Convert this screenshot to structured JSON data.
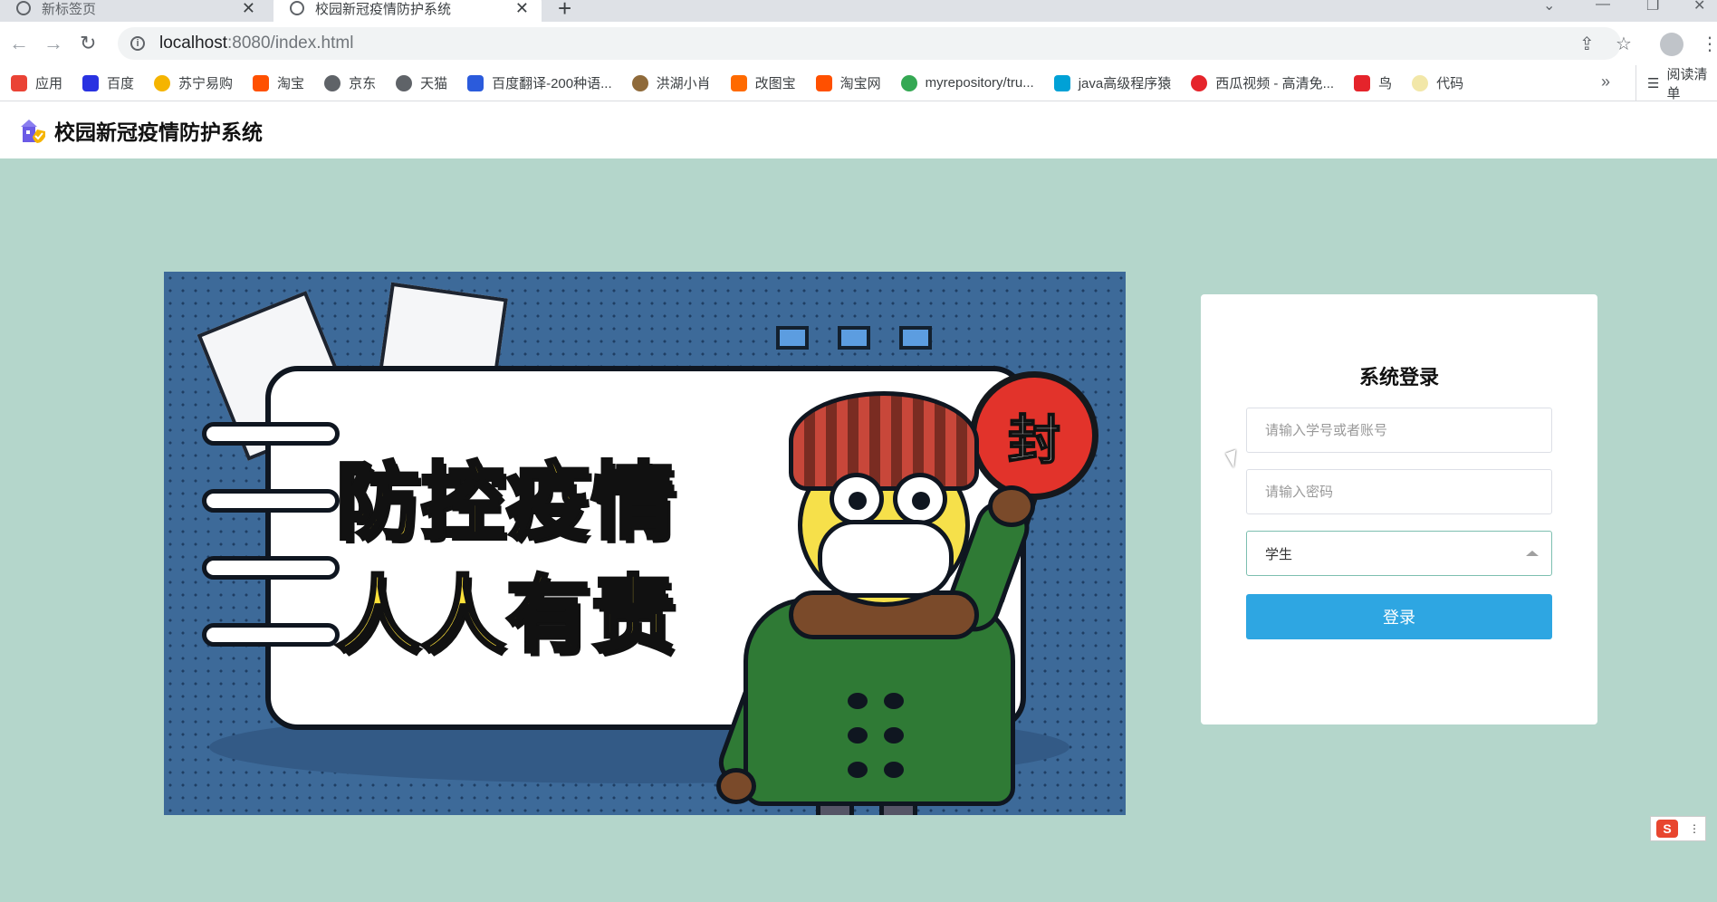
{
  "browser": {
    "tabs": [
      {
        "label": "新标签页"
      },
      {
        "label": "校园新冠疫情防护系统"
      }
    ],
    "url_host": "localhost",
    "url_rest": ":8080/index.html",
    "bookmarks": [
      {
        "label": "应用",
        "color": "#ea4335"
      },
      {
        "label": "百度",
        "color": "#2932e1"
      },
      {
        "label": "苏宁易购",
        "color": "#f5b400"
      },
      {
        "label": "淘宝",
        "color": "#ff5000"
      },
      {
        "label": "京东",
        "color": "#5f6368"
      },
      {
        "label": "天猫",
        "color": "#5f6368"
      },
      {
        "label": "百度翻译-200种语...",
        "color": "#2b5bdc"
      },
      {
        "label": "洪湖小肖",
        "color": "#8f6a3a"
      },
      {
        "label": "改图宝",
        "color": "#ff6a00"
      },
      {
        "label": "淘宝网",
        "color": "#ff5000"
      },
      {
        "label": "myrepository/tru...",
        "color": "#34a853"
      },
      {
        "label": "java高级程序猿",
        "color": "#00a1d6"
      },
      {
        "label": "西瓜视频 - 高清免...",
        "color": "#e5242b"
      },
      {
        "label": "鸟",
        "color": "#e5242b"
      },
      {
        "label": "代码",
        "color": "#f2e7a8"
      }
    ],
    "more": "»",
    "reading_list": "阅读清单"
  },
  "header": {
    "title": "校园新冠疫情防护系统"
  },
  "banner": {
    "line1": "防控疫情",
    "line2": "人人有责",
    "sign": "封"
  },
  "login": {
    "title": "系统登录",
    "username_placeholder": "请输入学号或者账号",
    "password_placeholder": "请输入密码",
    "role_selected": "学生",
    "submit_label": "登录"
  },
  "colors": {
    "page_bg": "#b4d6cb",
    "login_button": "#2ea6e2",
    "banner_bg": "#3d6a99"
  },
  "ime": {
    "label": "S"
  }
}
